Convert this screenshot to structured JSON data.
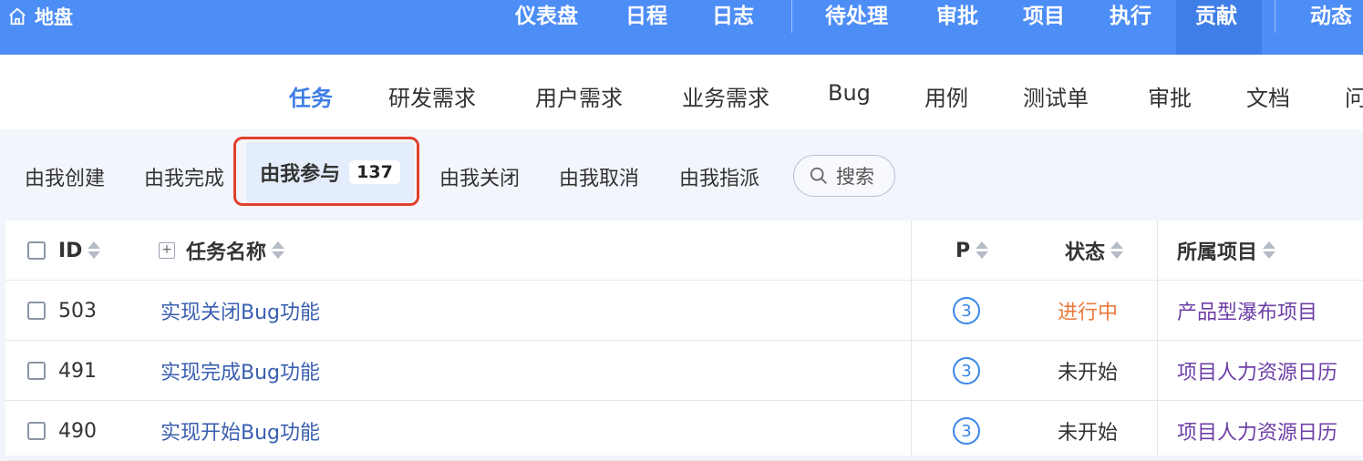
{
  "topbar": {
    "brand": "地盘",
    "nav": [
      "仪表盘",
      "日程",
      "日志",
      "待处理",
      "审批",
      "项目",
      "执行",
      "贡献",
      "动态"
    ],
    "active": "贡献"
  },
  "modules": [
    "任务",
    "研发需求",
    "用户需求",
    "业务需求",
    "Bug",
    "用例",
    "测试单",
    "审批",
    "文档",
    "问"
  ],
  "filters": {
    "items": [
      "由我创建",
      "由我完成",
      "由我参与",
      "由我关闭",
      "由我取消",
      "由我指派"
    ],
    "selected": "由我参与",
    "selected_count": "137",
    "search_label": "搜索"
  },
  "table": {
    "headers": {
      "id": "ID",
      "name": "任务名称",
      "pri": "P",
      "status": "状态",
      "project": "所属项目"
    },
    "rows": [
      {
        "id": "503",
        "name": "实现关闭Bug功能",
        "pri": "3",
        "status": "进行中",
        "project": "产品型瀑布项目"
      },
      {
        "id": "491",
        "name": "实现完成Bug功能",
        "pri": "3",
        "status": "未开始",
        "project": "项目人力资源日历"
      },
      {
        "id": "490",
        "name": "实现开始Bug功能",
        "pri": "3",
        "status": "未开始",
        "project": "项目人力资源日历"
      }
    ]
  },
  "colors": {
    "topbar": "#4d8df6",
    "active_tab": "#3f7ee6",
    "highlight": "#e0402c",
    "status_doing": "#ea7a3c",
    "project_link": "#6d3fa6"
  }
}
